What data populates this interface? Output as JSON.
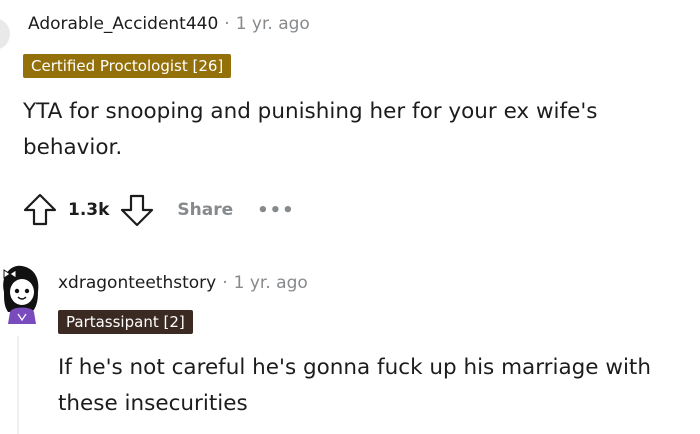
{
  "comment1": {
    "username": "Adorable_Accident440",
    "separator": "·",
    "time": "1 yr. ago",
    "flair": "Certified Proctologist [26]",
    "body": "YTA for snooping and punishing her for your ex wife's behavior.",
    "score": "1.3k",
    "share_label": "Share",
    "more_label": "•••"
  },
  "comment2": {
    "username": "xdragonteethstory",
    "separator": "·",
    "time": "1 yr. ago",
    "flair": "Partassipant [2]",
    "body": "If he's not careful he's gonna fuck up his marriage with these insecurities"
  },
  "colors": {
    "flair1_bg": "#94700a",
    "flair2_bg": "#3b2a22",
    "muted": "#878a8c",
    "text": "#1c1c1c"
  },
  "icons": [
    "upvote-icon",
    "downvote-icon",
    "more-icon",
    "avatar"
  ]
}
